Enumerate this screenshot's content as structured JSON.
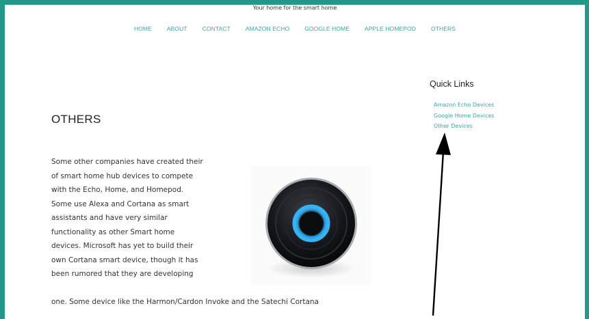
{
  "header": {
    "tagline": "Your home for the smart home"
  },
  "nav": {
    "items": [
      "HOME",
      "ABOUT",
      "CONTACT",
      "AMAZON ECHO",
      "GOOGLE HOME",
      "APPLE HOMEPOD",
      "OTHERS"
    ]
  },
  "main": {
    "title": "OTHERS",
    "paragraph_lines": [
      "Some other companies have created their",
      "of smart home hub devices to compete",
      "with the Echo, Home, and Homepod.",
      "Some use Alexa and Cortana as smart",
      "assistants and have very similar",
      "functionality as other Smart home",
      "devices. Microsoft has yet to build their",
      "own Cortana smart device, though it has",
      "been rumored that they are developing"
    ],
    "paragraph_tail": "one. Some device like the Harmon/Cardon Invoke and the Satechi Cortana",
    "image_icon": "cortana-speaker-image"
  },
  "sidebar": {
    "title": "Quick Links",
    "links": [
      "Amazon Echo Devices",
      "Google Home Devices",
      "Other Devices"
    ]
  },
  "annotation": {
    "icon": "arrow-annotation-icon",
    "color": "#000000"
  },
  "colors": {
    "frame": "#1f9a8a",
    "accent": "#3aa8a0",
    "text": "#333333"
  }
}
